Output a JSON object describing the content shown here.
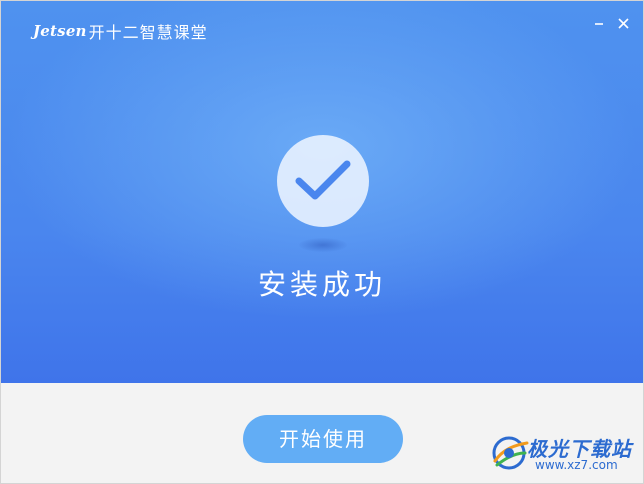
{
  "window": {
    "brand_logo": "Jetsen",
    "brand_name": "开十二智慧课堂",
    "minimize_label": "–",
    "close_label": "×"
  },
  "main": {
    "status_text": "安装成功",
    "icon": "checkmark-icon"
  },
  "footer": {
    "start_button_label": "开始使用"
  },
  "watermark": {
    "title": "极光下载站",
    "url": "www.xz7.com"
  },
  "colors": {
    "hero_blue": "#4a86ee",
    "button_blue": "#62adf5",
    "footer_bg": "#f3f3f3",
    "check_blue": "#4a86ee"
  }
}
